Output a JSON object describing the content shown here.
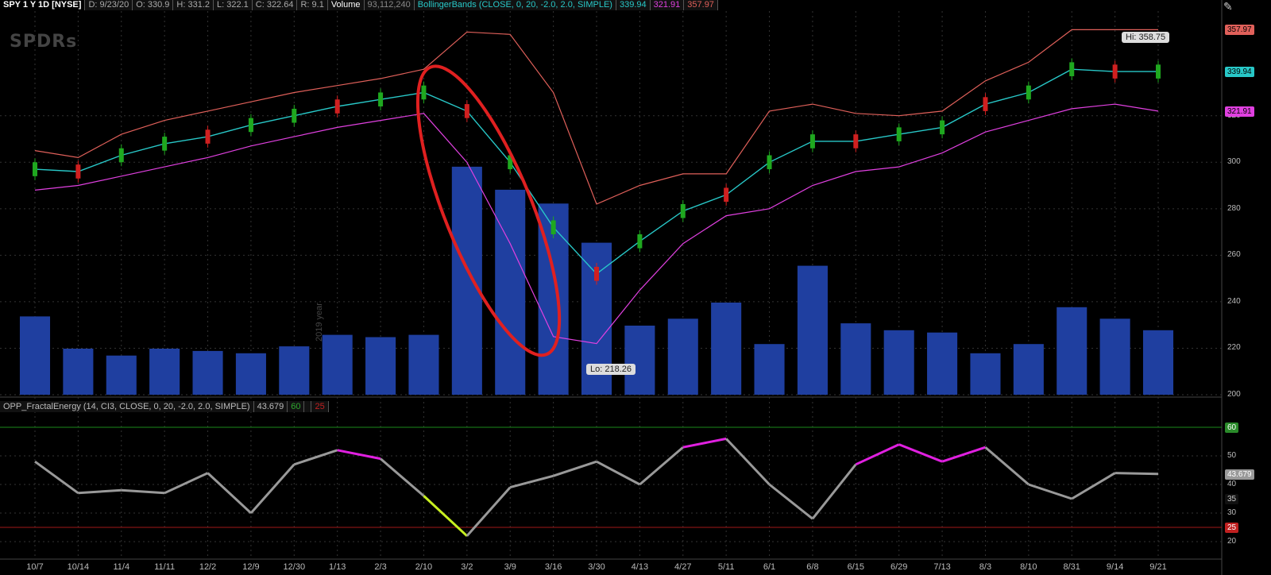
{
  "header": {
    "symbol": "SPY 1 Y 1D [NYSE]",
    "date": "D: 9/23/20",
    "open": "O: 330.9",
    "high": "H: 331.2",
    "low": "L: 322.1",
    "close": "C: 322.64",
    "range": "R: 9.1",
    "volume_label": "Volume",
    "volume_value": "93,112,240",
    "bb_label": "BollingerBands (CLOSE, 0, 20, -2.0, 2.0, SIMPLE)",
    "bb_mid": "339.94",
    "bb_low": "321.91",
    "bb_up": "357.97"
  },
  "indicator_header": {
    "label": "OPP_FractalEnergy (14, CI3, CLOSE, 0, 20, -2.0, 2.0, SIMPLE)",
    "value": "43.679",
    "upper": "60",
    "lower": "25"
  },
  "logo": "SPDRs",
  "year_label": "2019 year",
  "price_axis": {
    "ticks": [
      "320",
      "300",
      "280",
      "260",
      "240",
      "220",
      "200"
    ],
    "badges": [
      {
        "text": "357.97",
        "color": "#e0605a"
      },
      {
        "text": "339.94",
        "color": "#28c8c8"
      },
      {
        "text": "321.91",
        "color": "#e040e0"
      }
    ]
  },
  "ind_axis": {
    "ticks": [
      "50",
      "40",
      "30",
      "20"
    ],
    "badges": [
      {
        "text": "60",
        "color": "#2a8a2a"
      },
      {
        "text": "43.679",
        "color": "#999999"
      },
      {
        "text": "35",
        "color": "#111111"
      },
      {
        "text": "25",
        "color": "#c02020"
      }
    ]
  },
  "callouts": {
    "high": "Hi: 358.75",
    "low": "Lo: 218.26"
  },
  "x_axis": [
    "10/7",
    "10/14",
    "11/4",
    "11/11",
    "12/2",
    "12/9",
    "12/30",
    "1/13",
    "2/3",
    "2/10",
    "3/2",
    "3/9",
    "3/16",
    "3/30",
    "4/13",
    "4/27",
    "5/11",
    "6/1",
    "6/8",
    "6/15",
    "6/29",
    "7/13",
    "8/3",
    "8/10",
    "8/31",
    "9/14",
    "9/21"
  ],
  "colors": {
    "upper_band": "#e0605a",
    "middle_band": "#28c8c8",
    "lower_band": "#e040e0",
    "volume": "#1f3fa0",
    "candle_up": "#1fa81f",
    "candle_down": "#d02020",
    "annotation": "#e02020",
    "fe_neutral": "#999999",
    "fe_high": "#e020e0",
    "fe_low": "#c8f020"
  },
  "chart_data": {
    "type": "line",
    "price_range": [
      200,
      365
    ],
    "fractal_energy_range": [
      15,
      65
    ],
    "dates": [
      "10/7",
      "10/14",
      "11/4",
      "11/11",
      "12/2",
      "12/9",
      "12/30",
      "1/13",
      "2/3",
      "2/10",
      "3/2",
      "3/9",
      "3/16",
      "3/30",
      "4/13",
      "4/27",
      "5/11",
      "6/1",
      "6/8",
      "6/15",
      "6/29",
      "7/13",
      "8/3",
      "8/10",
      "8/31",
      "9/14",
      "9/21"
    ],
    "upper_band": [
      305,
      302,
      312,
      318,
      322,
      326,
      330,
      333,
      336,
      340,
      356,
      355,
      330,
      282,
      290,
      295,
      295,
      322,
      325,
      321,
      320,
      322,
      335,
      343,
      357,
      357,
      357
    ],
    "middle_band": [
      297,
      296,
      303,
      308,
      311,
      316,
      320,
      324,
      327,
      330,
      322,
      300,
      272,
      252,
      266,
      279,
      286,
      300,
      309,
      309,
      312,
      315,
      325,
      330,
      340,
      339,
      339
    ],
    "lower_band": [
      288,
      290,
      294,
      298,
      302,
      307,
      311,
      315,
      318,
      321,
      300,
      265,
      225,
      222,
      245,
      265,
      277,
      280,
      290,
      296,
      298,
      304,
      313,
      318,
      323,
      325,
      322
    ],
    "high_marker": 358.75,
    "low_marker": 218.26,
    "volume": [
      0.34,
      0.2,
      0.17,
      0.2,
      0.19,
      0.18,
      0.21,
      0.26,
      0.25,
      0.26,
      0.99,
      0.89,
      0.83,
      0.66,
      0.3,
      0.33,
      0.4,
      0.22,
      0.56,
      0.31,
      0.28,
      0.27,
      0.18,
      0.22,
      0.38,
      0.33,
      0.28
    ],
    "fractal_energy": [
      48,
      37,
      38,
      37,
      44,
      30,
      47,
      52,
      49,
      36,
      22,
      39,
      43,
      48,
      40,
      53,
      56,
      40,
      28,
      47,
      54,
      48,
      53,
      40,
      35,
      44,
      43.679
    ],
    "fractal_energy_levels": {
      "upper": 60,
      "lower": 25
    }
  }
}
